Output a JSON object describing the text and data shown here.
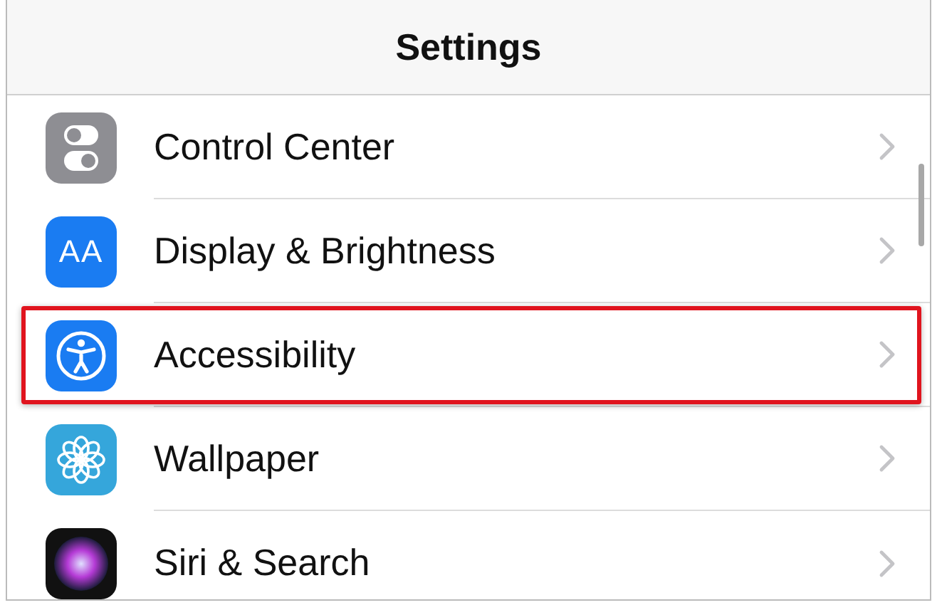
{
  "header": {
    "title": "Settings"
  },
  "rows": [
    {
      "label": "Control Center",
      "kind": "control-center",
      "highlighted": false
    },
    {
      "label": "Display & Brightness",
      "kind": "display",
      "icon_text": "AA",
      "highlighted": false
    },
    {
      "label": "Accessibility",
      "kind": "accessibility",
      "highlighted": true
    },
    {
      "label": "Wallpaper",
      "kind": "wallpaper",
      "highlighted": false
    },
    {
      "label": "Siri & Search",
      "kind": "siri",
      "highlighted": false
    }
  ]
}
